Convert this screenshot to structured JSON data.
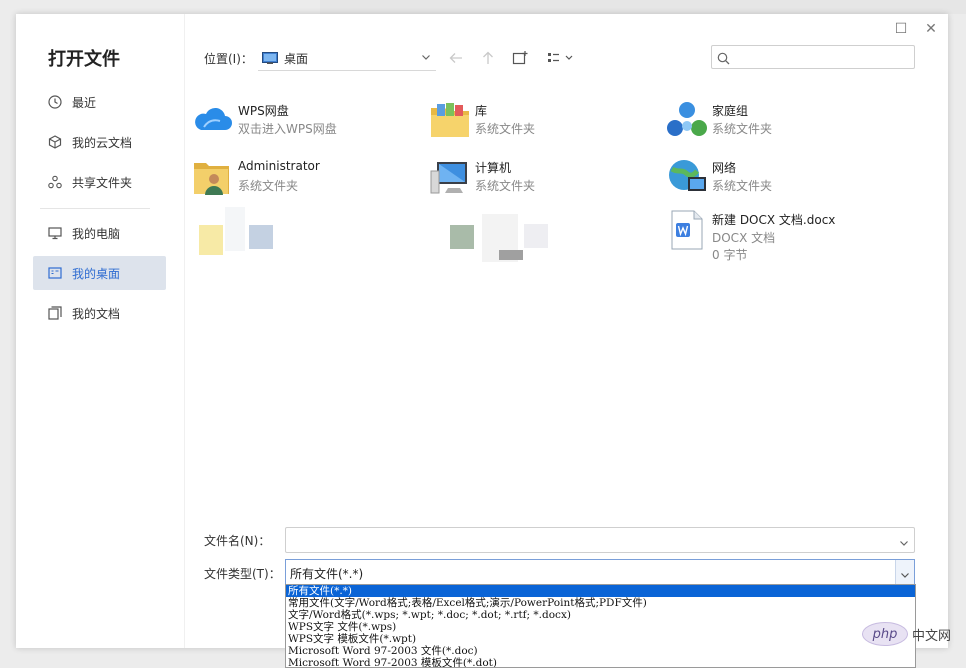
{
  "dialog": {
    "title": "打开文件"
  },
  "window_buttons": {
    "maximize": "☐",
    "close": "✕"
  },
  "sidebar": {
    "items": [
      {
        "label": "最近",
        "icon": "clock-icon"
      },
      {
        "label": "我的云文档",
        "icon": "cloud-cube-icon"
      },
      {
        "label": "共享文件夹",
        "icon": "share-icon"
      },
      {
        "label": "我的电脑",
        "icon": "monitor-icon"
      },
      {
        "label": "我的桌面",
        "icon": "desktop-icon",
        "active": true
      },
      {
        "label": "我的文档",
        "icon": "documents-icon"
      }
    ]
  },
  "toolbar": {
    "location_label": "位置(I)：",
    "location_value": "桌面",
    "search_placeholder": ""
  },
  "files": [
    {
      "name": "WPS网盘",
      "sub": "双击进入WPS网盘",
      "icon": "wps-cloud-icon"
    },
    {
      "name": "库",
      "sub": "系统文件夹",
      "icon": "library-folder-icon"
    },
    {
      "name": "家庭组",
      "sub": "系统文件夹",
      "icon": "homegroup-icon"
    },
    {
      "name": "Administrator",
      "sub": "系统文件夹",
      "icon": "user-folder-icon"
    },
    {
      "name": "计算机",
      "sub": "系统文件夹",
      "icon": "computer-icon"
    },
    {
      "name": "网络",
      "sub": "系统文件夹",
      "icon": "network-icon"
    },
    {
      "name": "新建 DOCX 文档.docx",
      "sub": "DOCX 文档",
      "sub2": "0 字节",
      "icon": "docx-file-icon"
    }
  ],
  "footer": {
    "filename_label": "文件名(N)：",
    "filename_value": "",
    "filetype_label": "文件类型(T)：",
    "filetype_value": "所有文件(*.*)"
  },
  "filetype_options": [
    "所有文件(*.*)",
    "常用文件(文字/Word格式;表格/Excel格式;演示/PowerPoint格式;PDF文件)",
    "文字/Word格式(*.wps; *.wpt; *.doc; *.dot; *.rtf; *.docx)",
    "WPS文字 文件(*.wps)",
    "WPS文字 模板文件(*.wpt)",
    "Microsoft Word 97-2003 文件(*.doc)",
    "Microsoft Word 97-2003 模板文件(*.dot)"
  ],
  "watermark": {
    "logo": "php",
    "text": "中文网"
  },
  "colors": {
    "accent": "#2e6cd1",
    "selected_bg": "#dde3ec",
    "dropdown_highlight": "#0a64d6"
  }
}
